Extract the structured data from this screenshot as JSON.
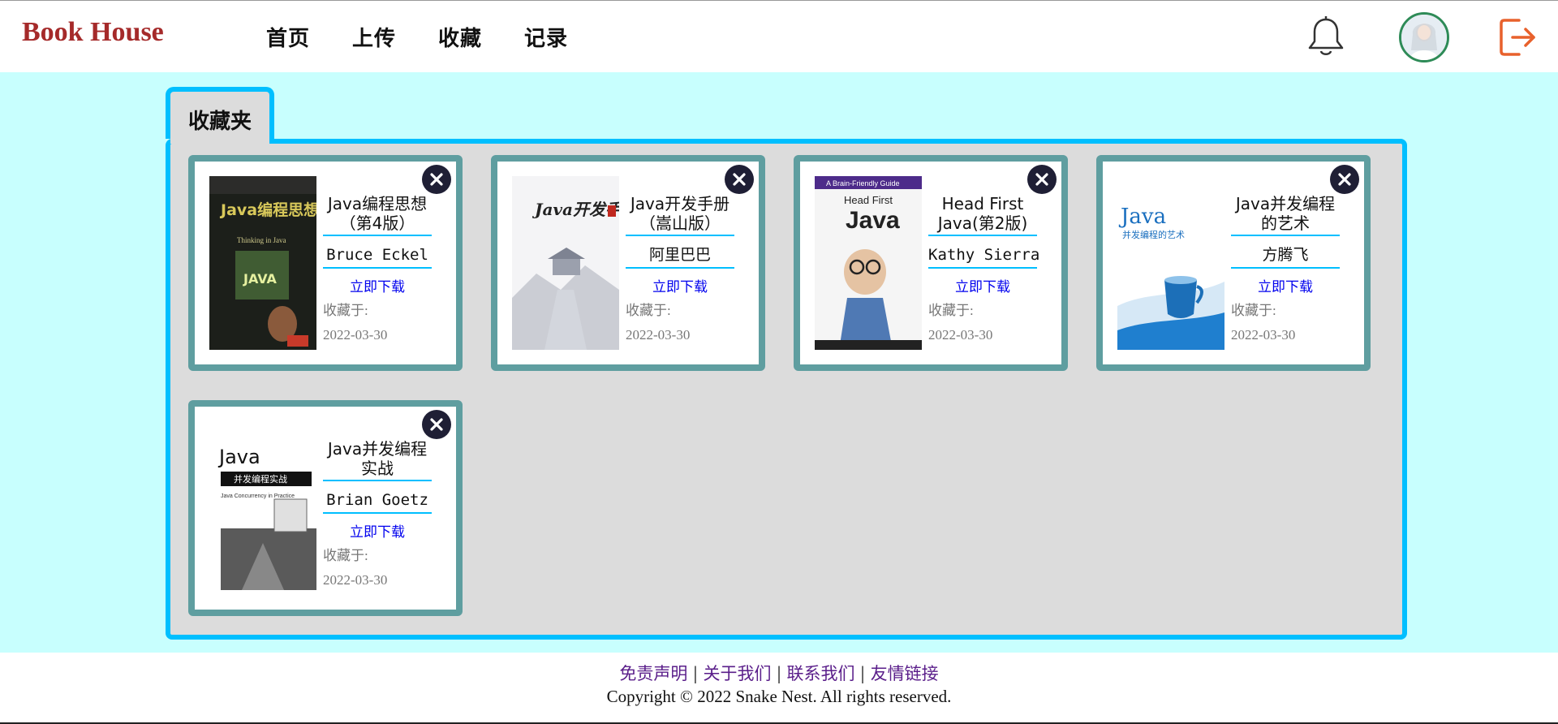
{
  "header": {
    "logo": "Book House",
    "nav": [
      "首页",
      "上传",
      "收藏",
      "记录"
    ]
  },
  "folder": {
    "tab_label": "收藏夹"
  },
  "cards": [
    {
      "title": "Java编程思想（第4版）",
      "author": "Bruce Eckel",
      "download": "立即下载",
      "saved_label": "收藏于:",
      "saved_date": "2022-03-30"
    },
    {
      "title": "Java开发手册（嵩山版）",
      "author": "阿里巴巴",
      "download": "立即下载",
      "saved_label": "收藏于:",
      "saved_date": "2022-03-30"
    },
    {
      "title": "Head First Java(第2版)",
      "author": "Kathy Sierra",
      "download": "立即下载",
      "saved_label": "收藏于:",
      "saved_date": "2022-03-30"
    },
    {
      "title": "Java并发编程的艺术",
      "author": "方腾飞",
      "download": "立即下载",
      "saved_label": "收藏于:",
      "saved_date": "2022-03-30"
    },
    {
      "title": "Java并发编程实战",
      "author": "Brian Goetz",
      "download": "立即下载",
      "saved_label": "收藏于:",
      "saved_date": "2022-03-30"
    }
  ],
  "covers": [
    {
      "text": "Java编程思想",
      "subtext": "Thinking in Java",
      "badge": "JAVA"
    },
    {
      "text": "Java开发手册",
      "subtext": ""
    },
    {
      "text": "Java",
      "subtext": "A Brain-Friendly Guide",
      "header": "Head First"
    },
    {
      "text": "Java",
      "subtext": "并发编程的艺术"
    },
    {
      "text": "Java",
      "subtext": "并发编程实战",
      "small": "Java Concurrency in Practice"
    }
  ],
  "footer": {
    "links": [
      "免责声明",
      "关于我们",
      "联系我们",
      "友情链接"
    ],
    "copyright": "Copyright © 2022 Snake Nest. All rights reserved."
  },
  "colors": {
    "logo": "#a52a2a",
    "main_bg": "#c8fffe",
    "panel_border": "#00bfff",
    "card_border": "#5f9ea0",
    "link": "#0000ee",
    "footer_link": "#5a1e8a",
    "logout_icon": "#e8612c"
  },
  "icons": {
    "bell": "bell-icon",
    "avatar": "user-avatar",
    "logout": "logout-icon",
    "close": "close-icon"
  }
}
